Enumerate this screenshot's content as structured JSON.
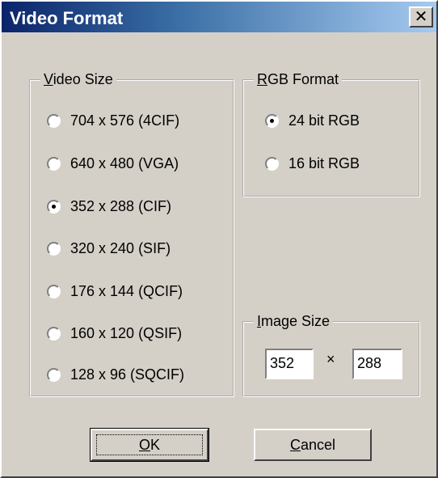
{
  "window": {
    "title": "Video Format",
    "close_glyph": "✕",
    "colors": {
      "titlebar_start": "#0a246a",
      "titlebar_end": "#a6caf0",
      "face": "#d4d0c8"
    }
  },
  "video_size": {
    "legend_mnemonic": "V",
    "legend_rest": "ideo Size",
    "options": [
      {
        "label": "704 x 576 (4CIF)",
        "selected": false
      },
      {
        "label": "640 x 480 (VGA)",
        "selected": false
      },
      {
        "label": "352 x 288 (CIF)",
        "selected": true
      },
      {
        "label": "320 x 240 (SIF)",
        "selected": false
      },
      {
        "label": "176 x 144 (QCIF)",
        "selected": false
      },
      {
        "label": "160 x 120 (QSIF)",
        "selected": false
      },
      {
        "label": "128 x 96 (SQCIF)",
        "selected": false
      }
    ]
  },
  "rgb_format": {
    "legend_mnemonic": "R",
    "legend_rest": "GB Format",
    "options": [
      {
        "label": "24 bit RGB",
        "selected": true
      },
      {
        "label": "16 bit RGB",
        "selected": false
      }
    ]
  },
  "image_size": {
    "legend_mnemonic": "I",
    "legend_rest": "mage Size",
    "width_value": "352",
    "times_glyph": "×",
    "height_value": "288"
  },
  "buttons": {
    "ok_mnemonic": "O",
    "ok_rest": "K",
    "cancel_mnemonic": "C",
    "cancel_rest": "ancel"
  }
}
